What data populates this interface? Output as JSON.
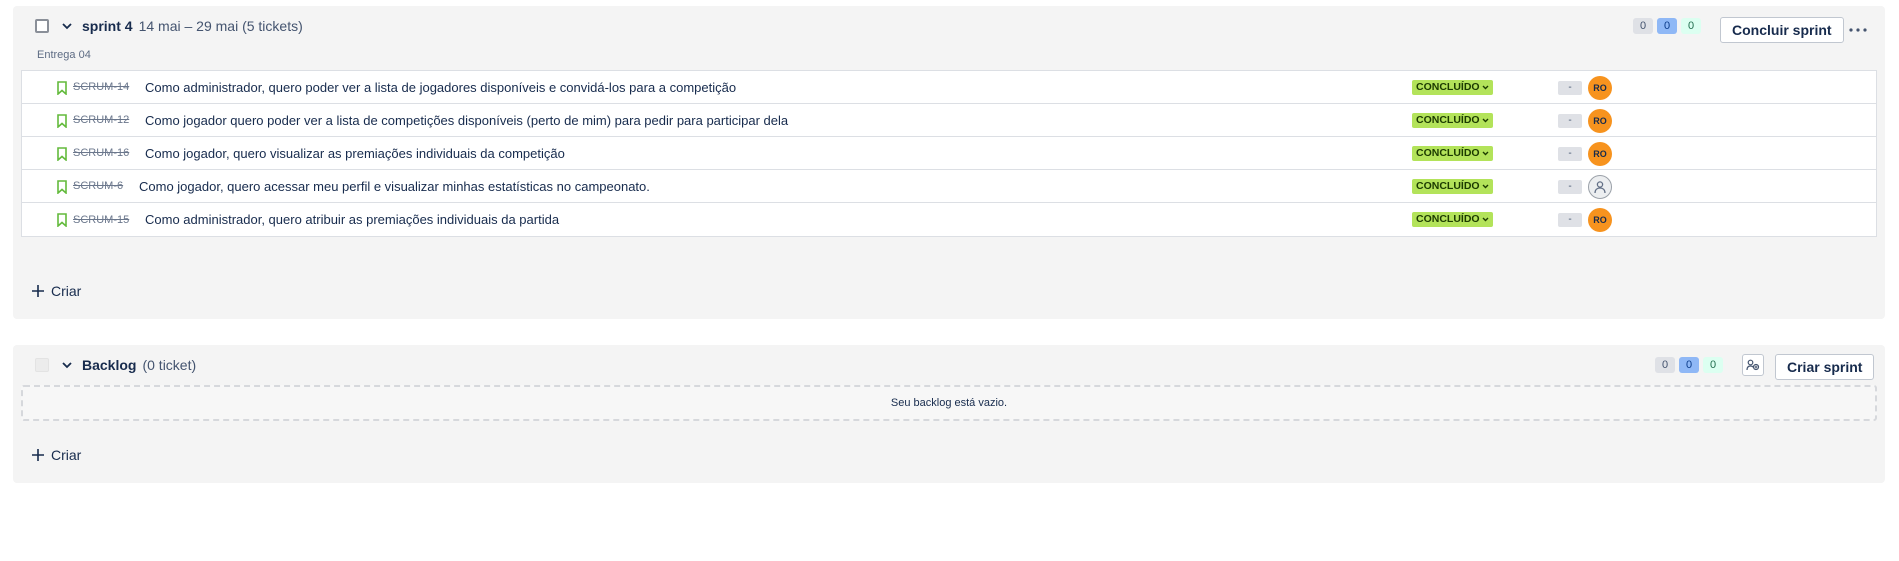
{
  "sprint": {
    "name": "sprint 4",
    "meta": "14 mai – 29 mai (5 tickets)",
    "subtitle": "Entrega 04",
    "counts": {
      "todo": "0",
      "in_progress": "0",
      "done": "0"
    },
    "complete_label": "Concluir sprint",
    "create_label": "Criar",
    "issues": [
      {
        "key": "SCRUM-14",
        "summary": "Como administrador, quero poder ver a lista de jogadores disponíveis e convidá-los para a competição",
        "status": "CONCLUÍDO",
        "estimate": "-",
        "assignee": "RO"
      },
      {
        "key": "SCRUM-12",
        "summary": "Como jogador quero poder ver a lista de competições disponíveis (perto de mim) para pedir para participar dela",
        "status": "CONCLUÍDO",
        "estimate": "-",
        "assignee": "RO"
      },
      {
        "key": "SCRUM-16",
        "summary": "Como jogador, quero visualizar as premiações individuais da competição",
        "status": "CONCLUÍDO",
        "estimate": "-",
        "assignee": "RO"
      },
      {
        "key": "SCRUM-6",
        "summary": "Como jogador, quero acessar meu perfil e visualizar minhas estatísticas no campeonato.",
        "status": "CONCLUÍDO",
        "estimate": "-",
        "assignee": ""
      },
      {
        "key": "SCRUM-15",
        "summary": "Como administrador, quero atribuir as premiações individuais da partida",
        "status": "CONCLUÍDO",
        "estimate": "-",
        "assignee": "RO"
      }
    ]
  },
  "backlog": {
    "name": "Backlog",
    "meta": "(0 ticket)",
    "counts": {
      "todo": "0",
      "in_progress": "0",
      "done": "0"
    },
    "create_sprint_label": "Criar sprint",
    "empty_message": "Seu backlog está vazio.",
    "create_label": "Criar"
  },
  "colors": {
    "status_done": "#b3e35a",
    "avatar": "#f7931e",
    "story_icon": "#63ba3c",
    "in_progress_count": "#8fb8f6"
  },
  "icons": {
    "issue_type": "bookmark-icon",
    "expand": "chevron-down-icon",
    "more": "more-horizontal-icon",
    "create": "plus-icon",
    "unassigned": "person-icon",
    "backlog_action": "link-people-icon"
  }
}
